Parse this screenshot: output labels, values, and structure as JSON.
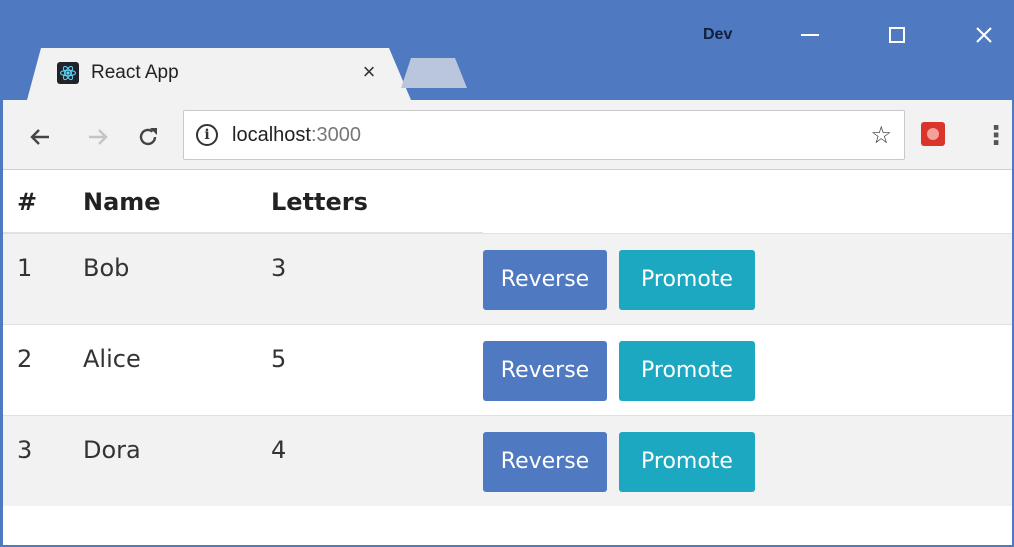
{
  "window": {
    "profile": "Dev",
    "tab": {
      "title": "React App",
      "close_glyph": "×"
    }
  },
  "toolbar": {
    "url_host": "localhost",
    "url_port": ":3000"
  },
  "table": {
    "headers": [
      "#",
      "Name",
      "Letters"
    ],
    "rows": [
      {
        "index": "1",
        "name": "Bob",
        "letters": "3",
        "reverse_label": "Reverse",
        "promote_label": "Promote"
      },
      {
        "index": "2",
        "name": "Alice",
        "letters": "5",
        "reverse_label": "Reverse",
        "promote_label": "Promote"
      },
      {
        "index": "3",
        "name": "Dora",
        "letters": "4",
        "reverse_label": "Reverse",
        "promote_label": "Promote"
      }
    ]
  },
  "colors": {
    "title_bar": "#4f79c1",
    "reverse_button": "#4f79c1",
    "promote_button": "#1ba8c0",
    "striped_row": "#f2f2f2"
  },
  "icons": {
    "favicon": "react-logo-icon",
    "back": "arrow-left-icon",
    "forward": "arrow-right-icon",
    "reload": "reload-icon",
    "info": "info-icon",
    "bookmark": "star-icon",
    "extension": "extension-icon",
    "menu": "kebab-menu-icon"
  }
}
